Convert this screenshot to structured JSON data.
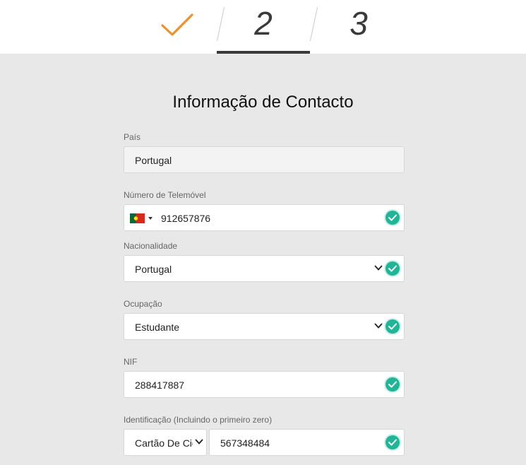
{
  "steps": [
    {
      "label": "",
      "state": "done",
      "icon": "check-icon",
      "color": "#f0902a"
    },
    {
      "label": "2",
      "state": "current"
    },
    {
      "label": "3",
      "state": "upcoming"
    }
  ],
  "form": {
    "title": "Informação de Contacto",
    "country": {
      "label": "País",
      "value": "Portugal"
    },
    "phone": {
      "label": "Número de Telemóvel",
      "value": "912657876",
      "flag_icon": "portugal-flag-icon"
    },
    "nationality": {
      "label": "Nacionalidade",
      "value": "Portugal"
    },
    "occupation": {
      "label": "Ocupação",
      "value": "Estudante"
    },
    "nif": {
      "label": "NIF",
      "value": "288417887"
    },
    "identification": {
      "label": "Identificação (Incluindo o primeiro zero)",
      "type_value": "Cartão De Cidadão",
      "number_value": "567348484"
    }
  },
  "colors": {
    "valid": "#1fb596",
    "done_check": "#f0902a",
    "active_step": "#3a3a3a"
  }
}
